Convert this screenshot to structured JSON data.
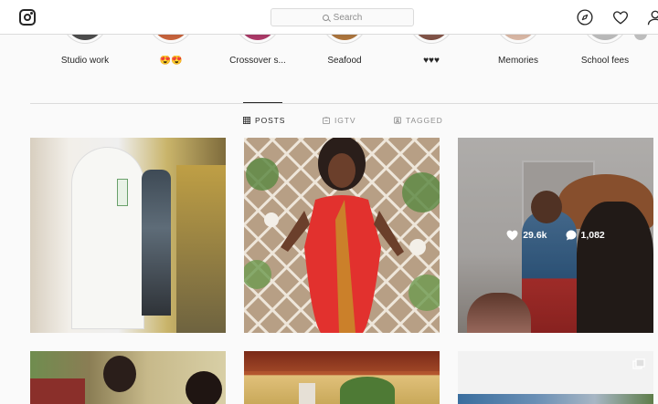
{
  "header": {
    "search_placeholder": "Search"
  },
  "highlights": [
    {
      "label": "Studio work",
      "color": "#4b4b4b"
    },
    {
      "label": "😍😍",
      "color": "#8a3b2b"
    },
    {
      "label": "Crossover s...",
      "color": "#5c2a3a"
    },
    {
      "label": "Seafood",
      "color": "#6f5a3e"
    },
    {
      "label": "♥♥♥",
      "color": "#9e6f62"
    },
    {
      "label": "Memories",
      "color": "#a07766"
    },
    {
      "label": "School fees",
      "color": "#c8c8c8"
    }
  ],
  "tabs": [
    {
      "label": "POSTS",
      "active": true,
      "icon": "grid-icon"
    },
    {
      "label": "IGTV",
      "active": false,
      "icon": "igtv-icon"
    },
    {
      "label": "TAGGED",
      "active": false,
      "icon": "tagged-icon"
    }
  ],
  "posts": [
    {
      "id": "post-1",
      "likes": "",
      "comments": ""
    },
    {
      "id": "post-2",
      "likes": "",
      "comments": ""
    },
    {
      "id": "post-3",
      "likes": "29.6k",
      "comments": "1,082"
    },
    {
      "id": "post-4",
      "likes": "",
      "comments": ""
    },
    {
      "id": "post-5",
      "likes": "",
      "comments": ""
    },
    {
      "id": "post-6",
      "likes": "",
      "comments": ""
    }
  ],
  "colors": {
    "background": "#fafafa",
    "border": "#dbdbdb",
    "text": "#262626",
    "muted": "#8e8e8e"
  }
}
